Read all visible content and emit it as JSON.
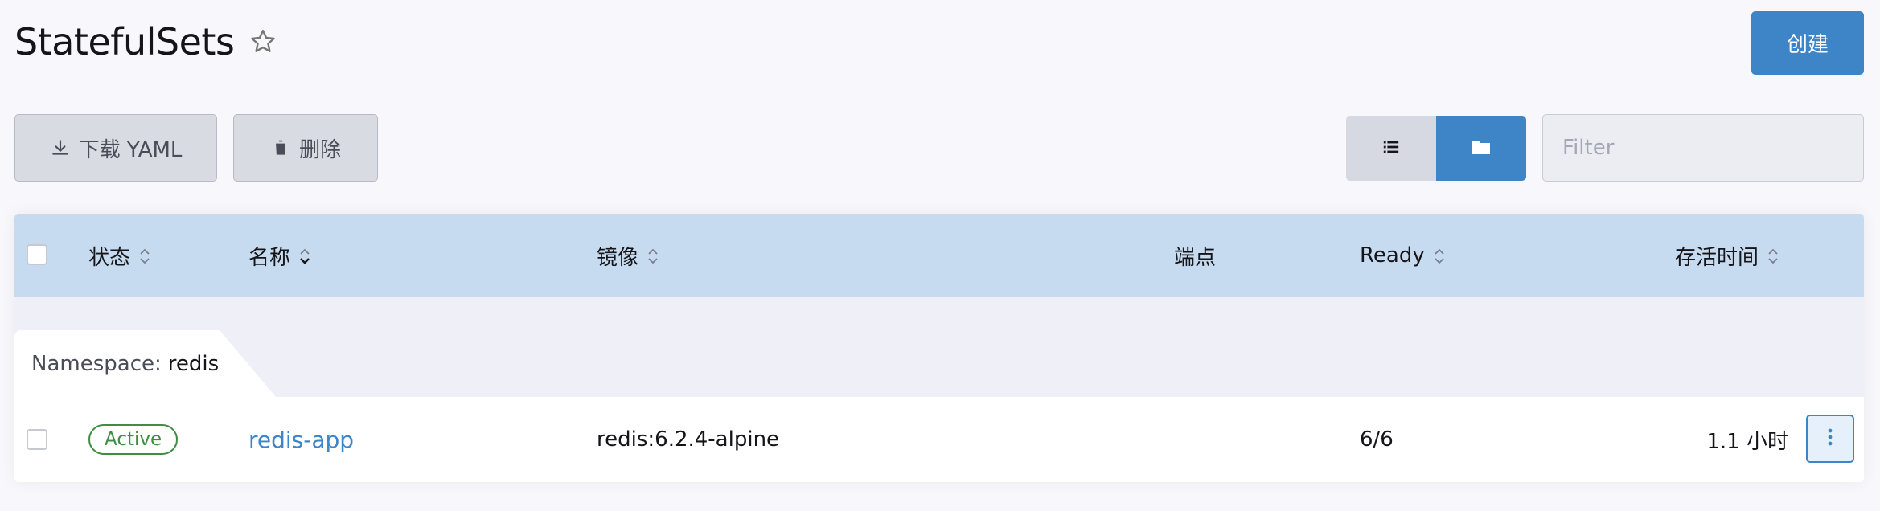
{
  "header": {
    "title": "StatefulSets",
    "star_icon": "star-outline-icon",
    "create_label": "创建"
  },
  "toolbar": {
    "download_label": "下载 YAML",
    "delete_label": "删除",
    "filter_placeholder": "Filter",
    "view_mode": "group-by-namespace"
  },
  "colors": {
    "accent": "#3d85c6",
    "header_bg": "#c6dbef",
    "active": "#3f8d43"
  },
  "table": {
    "columns": [
      "状态",
      "名称",
      "镜像",
      "端点",
      "Ready",
      "存活时间"
    ],
    "groups": [
      {
        "namespace_label": "Namespace:",
        "namespace": "redis",
        "rows": [
          {
            "state": "Active",
            "name": "redis-app",
            "image": "redis:6.2.4-alpine",
            "endpoints": "",
            "ready": "6/6",
            "age": "1.1 小时"
          }
        ]
      }
    ]
  }
}
